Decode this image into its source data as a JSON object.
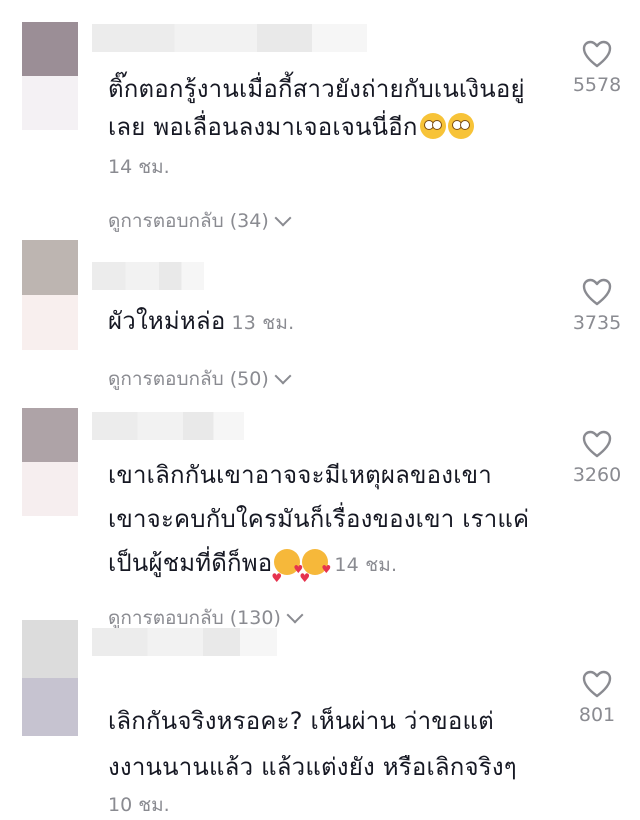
{
  "comments": [
    {
      "text": "ติ๊กตอกรู้งานเมื่อกี้สาวยังถ่ายกับเนเงินอยู่เลย พอเลื่อนลงมาเจอเจนนี่อีก",
      "emoji": "flushed-face",
      "time": "14 ชม.",
      "replies": "ดูการตอบกลับ (34)",
      "likes": "5578",
      "avatar_colors": [
        "#9b8e96",
        "#f4f1f4"
      ]
    },
    {
      "text": "ผัวใหม่หล่อ",
      "time": "13 ชม.",
      "replies": "ดูการตอบกลับ (50)",
      "likes": "3735",
      "avatar_colors": [
        "#bdb5b1",
        "#f8efee"
      ]
    },
    {
      "text": "เขาเลิกกันเขาอาจจะมีเหตุผลของเขา เขาจะคบกับใครมันก็เรื่องของเขา เราแค่เป็นผู้ชมที่ดีก็พอ",
      "emoji": "smiling-face-with-hearts",
      "time": "14 ชม.",
      "replies": "ดูการตอบกลับ (130)",
      "likes": "3260",
      "avatar_colors": [
        "#aea3a7",
        "#f6eeef"
      ]
    },
    {
      "text": "เลิกกันจริงหรอคะ? เห็นผ่าน ว่าขอแต่งงานนานแล้ว แล้วแต่งยัง หรือเลิกจริงๆ",
      "time": "10 ชม.",
      "likes": "801",
      "avatar_colors": [
        "#dcdcdc",
        "#c6c3d0"
      ]
    }
  ],
  "lines": {
    "c1_l1": "ติ๊กตอกรู้งานเมื่อกี้สาวยังถ่ายกับเนเงินอยู่",
    "c1_l2": "เลย พอเลื่อนลงมาเจอเจนนี่อีก",
    "c3_l1": "เขาเลิกกันเขาอาจจะมีเหตุผลของเขา",
    "c3_l2": "เขาจะคบกับใครมันก็เรื่องของเขา เราแค่",
    "c3_l3": "เป็นผู้ชมที่ดีก็พอ",
    "c4_l1": "เลิกกันจริงหรอคะ? เห็นผ่าน ว่าขอแต่",
    "c4_l2": "งงานนานแล้ว แล้วแต่งยัง หรือเลิกจริงๆ"
  },
  "icons": {
    "like": "heart-outline-icon",
    "replies": "chevron-down-icon"
  }
}
